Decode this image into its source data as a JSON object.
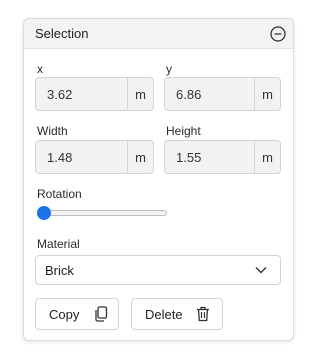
{
  "panel": {
    "title": "Selection",
    "collapse_icon": "minus-circle-icon"
  },
  "fields": {
    "x": {
      "label": "x",
      "value": "3.62",
      "unit": "m"
    },
    "y": {
      "label": "y",
      "value": "6.86",
      "unit": "m"
    },
    "width": {
      "label": "Width",
      "value": "1.48",
      "unit": "m"
    },
    "height": {
      "label": "Height",
      "value": "1.55",
      "unit": "m"
    }
  },
  "rotation": {
    "label": "Rotation",
    "value_fraction": 0
  },
  "material": {
    "label": "Material",
    "selected": "Brick"
  },
  "actions": {
    "copy_label": "Copy",
    "copy_icon": "copy-icon",
    "delete_label": "Delete",
    "delete_icon": "trash-icon"
  },
  "colors": {
    "accent": "#1a73e8",
    "header_bg": "#f3f3f3",
    "field_bg": "#f2f2f2"
  }
}
